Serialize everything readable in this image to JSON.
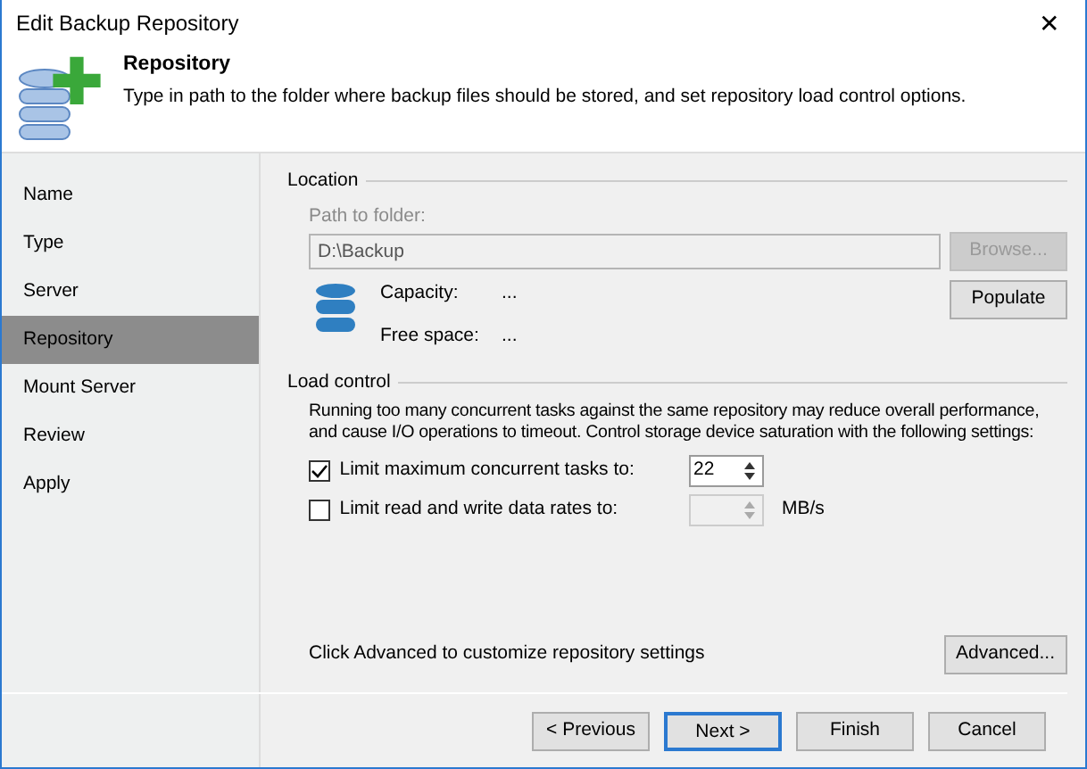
{
  "window": {
    "title": "Edit Backup Repository",
    "close": "✕"
  },
  "header": {
    "title": "Repository",
    "description": "Type in path to the folder where backup files should be stored, and set repository load control options."
  },
  "steps": [
    {
      "label": "Name",
      "selected": false
    },
    {
      "label": "Type",
      "selected": false
    },
    {
      "label": "Server",
      "selected": false
    },
    {
      "label": "Repository",
      "selected": true
    },
    {
      "label": "Mount Server",
      "selected": false
    },
    {
      "label": "Review",
      "selected": false
    },
    {
      "label": "Apply",
      "selected": false
    }
  ],
  "location": {
    "label": "Location",
    "path_label": "Path to folder:",
    "path_value": "D:\\Backup",
    "path_disabled": true,
    "browse": {
      "label": "Browse...",
      "disabled": true
    },
    "capacity_label": "Capacity:",
    "capacity_value": "...",
    "free_label": "Free space:",
    "free_value": "...",
    "populate": {
      "label": "Populate",
      "disabled": false
    }
  },
  "load_control": {
    "label": "Load control",
    "description": "Running too many concurrent tasks against the same repository may reduce overall performance, and cause I/O operations to timeout. Control storage device saturation with the following settings:",
    "options": [
      {
        "label": "Limit maximum concurrent tasks to:",
        "checked": true,
        "value": "22"
      },
      {
        "label": "Limit read and write data rates to:",
        "checked": false,
        "unit": "MB/s"
      }
    ]
  },
  "advanced": {
    "hint": "Click Advanced to customize repository settings",
    "button": "Advanced..."
  },
  "buttons": [
    {
      "label": "< Previous",
      "default": false
    },
    {
      "label": "Next >",
      "default": true
    },
    {
      "label": "Finish",
      "default": false
    },
    {
      "label": "Cancel",
      "default": false
    }
  ]
}
